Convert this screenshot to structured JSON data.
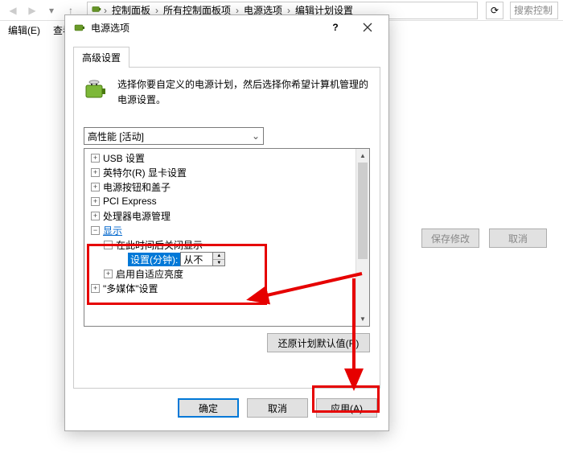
{
  "explorer": {
    "breadcrumb": [
      "控制面板",
      "所有控制面板项",
      "电源选项",
      "编辑计划设置"
    ],
    "search_placeholder": "搜索控制",
    "menu": {
      "edit": "编辑(E)",
      "view": "查看"
    }
  },
  "bg_buttons": {
    "save": "保存修改",
    "cancel": "取消"
  },
  "dialog": {
    "title": "电源选项",
    "tab": "高级设置",
    "intro": "选择你要自定义的电源计划，然后选择你希望计算机管理的电源设置。",
    "plan_selected": "高性能 [活动]",
    "tree": {
      "usb": "USB 设置",
      "intel": "英特尔(R) 显卡设置",
      "power_btn": "电源按钮和盖子",
      "pci": "PCI Express",
      "cpu": "处理器电源管理",
      "display": "显示",
      "display_off": "在此时间后关闭显示",
      "setting_label": "设置(分钟):",
      "setting_value": "从不",
      "adaptive": "启用自适应亮度",
      "multimedia": "\"多媒体\"设置"
    },
    "restore": "还原计划默认值(R)",
    "ok": "确定",
    "cancel": "取消",
    "apply": "应用(A)"
  }
}
